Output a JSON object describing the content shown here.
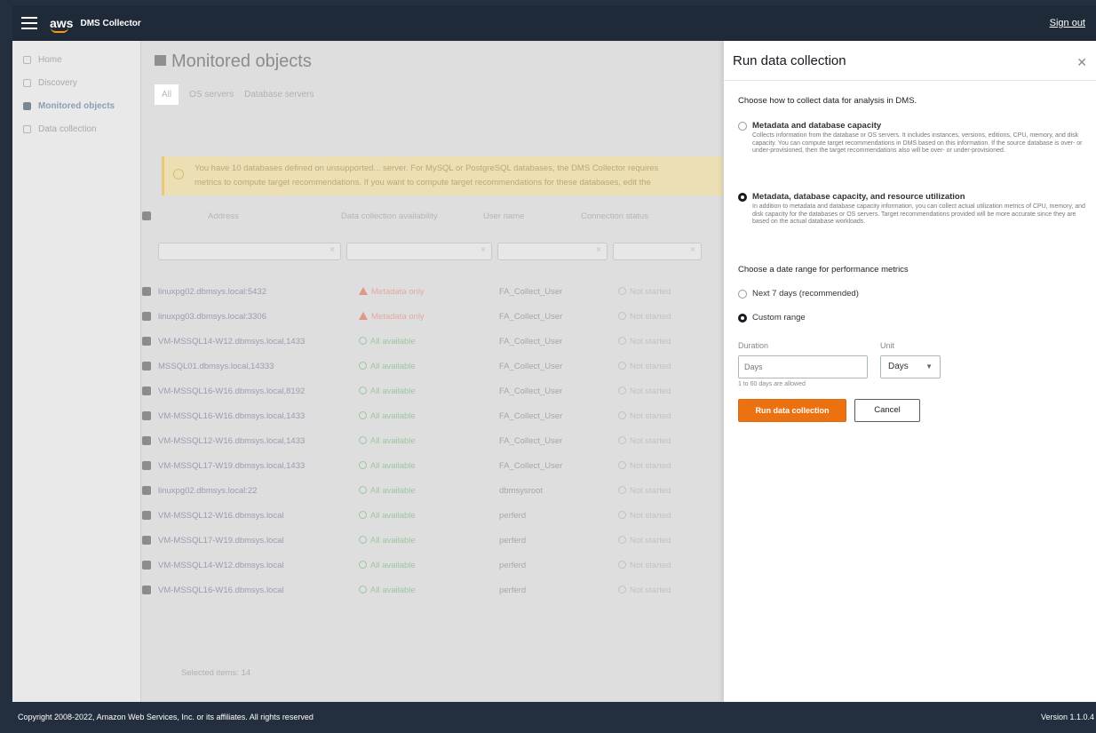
{
  "header": {
    "logo": "aws",
    "app_name": "DMS Collector",
    "sign_out": "Sign out"
  },
  "sidebar": {
    "items": [
      {
        "label": "Home",
        "active": false
      },
      {
        "label": "Discovery",
        "active": false
      },
      {
        "label": "Monitored objects",
        "active": true
      },
      {
        "label": "Data collection",
        "active": false
      }
    ]
  },
  "main": {
    "title": "Monitored objects",
    "tabs": [
      "All",
      "OS servers",
      "Database servers"
    ],
    "notice": [
      "You have 10 databases defined on unsupported... server. For MySQL or PostgreSQL databases, the DMS Collector requires",
      "metrics to compute target recommendations. If you want to compute target recommendations for these databases, edit the"
    ],
    "columns": [
      "Address",
      "Data collection availability",
      "User name",
      "Connection status"
    ],
    "rows": [
      {
        "address": "linuxpg02.dbmsys.local:5432",
        "availability": "Metadata only",
        "status": "warn",
        "user": "FA_Collect_User",
        "connection": "Not started"
      },
      {
        "address": "linuxpg03.dbmsys.local:3306",
        "availability": "Metadata only",
        "status": "warn",
        "user": "FA_Collect_User",
        "connection": "Not started"
      },
      {
        "address": "VM-MSSQL14-W12.dbmsys.local,1433",
        "availability": "All available",
        "status": "ok",
        "user": "FA_Collect_User",
        "connection": "Not started"
      },
      {
        "address": "MSSQL01.dbmsys.local,14333",
        "availability": "All available",
        "status": "ok",
        "user": "FA_Collect_User",
        "connection": "Not started"
      },
      {
        "address": "VM-MSSQL16-W16.dbmsys.local,8192",
        "availability": "All available",
        "status": "ok",
        "user": "FA_Collect_User",
        "connection": "Not started"
      },
      {
        "address": "VM-MSSQL16-W16.dbmsys.local,1433",
        "availability": "All available",
        "status": "ok",
        "user": "FA_Collect_User",
        "connection": "Not started"
      },
      {
        "address": "VM-MSSQL12-W16.dbmsys.local,1433",
        "availability": "All available",
        "status": "ok",
        "user": "FA_Collect_User",
        "connection": "Not started"
      },
      {
        "address": "VM-MSSQL17-W19.dbmsys.local,1433",
        "availability": "All available",
        "status": "ok",
        "user": "FA_Collect_User",
        "connection": "Not started"
      },
      {
        "address": "linuxpg02.dbmsys.local:22",
        "availability": "All available",
        "status": "ok",
        "user": "dbmsysroot",
        "connection": "Not started"
      },
      {
        "address": "VM-MSSQL12-W16.dbmsys.local",
        "availability": "All available",
        "status": "ok",
        "user": "perferd",
        "connection": "Not started"
      },
      {
        "address": "VM-MSSQL17-W19.dbmsys.local",
        "availability": "All available",
        "status": "ok",
        "user": "perferd",
        "connection": "Not started"
      },
      {
        "address": "VM-MSSQL14-W12.dbmsys.local",
        "availability": "All available",
        "status": "ok",
        "user": "perferd",
        "connection": "Not started"
      },
      {
        "address": "VM-MSSQL16-W16.dbmsys.local",
        "availability": "All available",
        "status": "ok",
        "user": "perferd",
        "connection": "Not started"
      }
    ],
    "selected_text": "Selected items: 14"
  },
  "panel": {
    "title": "Run data collection",
    "intro": "Choose how to collect data for analysis in DMS.",
    "options": [
      {
        "title": "Metadata and database capacity",
        "desc": "Collects information from the database or OS servers. It includes instances, versions, editions, CPU, memory, and disk capacity. You can compute target recommendations in DMS based on this information. If the source database is over- or under-provisioned, then the target recommendations also will be over- or under-provisioned.",
        "selected": false
      },
      {
        "title": "Metadata, database capacity, and resource utilization",
        "desc": "In addition to metadata and database capacity information, you can collect actual utilization metrics of CPU, memory, and disk capacity for the databases or OS servers. Target recommendations provided will be more accurate since they are based on the actual database workloads.",
        "selected": true
      }
    ],
    "range_label": "Choose a date range for performance metrics",
    "ranges": [
      {
        "label": "Next 7 days (recommended)",
        "selected": false
      },
      {
        "label": "Custom range",
        "selected": true
      }
    ],
    "duration_label": "Duration",
    "duration_placeholder": "Days",
    "unit_label": "Unit",
    "unit_value": "Days",
    "duration_hint": "1 to 60 days are allowed",
    "run_button": "Run data collection",
    "cancel_button": "Cancel"
  },
  "footer": {
    "copyright": "Copyright 2008-2022, Amazon Web Services, Inc. or its affiliates. All rights reserved",
    "version": "Version 1.1.0.4"
  }
}
